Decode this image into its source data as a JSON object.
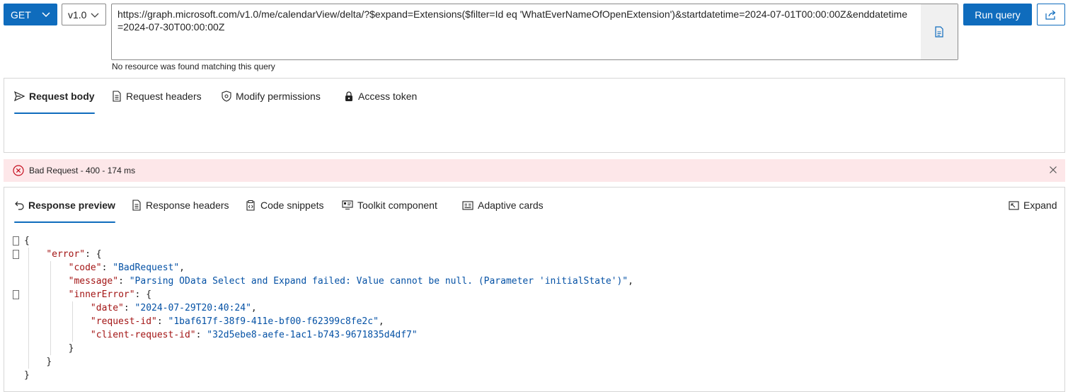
{
  "query": {
    "method": "GET",
    "version": "v1.0",
    "url": "https://graph.microsoft.com/v1.0/me/calendarView/delta/?$expand=Extensions($filter=Id eq 'WhatEverNameOfOpenExtension')&startdatetime=2024-07-01T00:00:00Z&enddatetime=2024-07-30T00:00:00Z",
    "hint": "No resource was found matching this query",
    "run_label": "Run query"
  },
  "request_tabs": [
    {
      "label": "Request body",
      "icon": "send-icon"
    },
    {
      "label": "Request headers",
      "icon": "document-icon"
    },
    {
      "label": "Modify permissions",
      "icon": "shield-icon"
    },
    {
      "label": "Access token",
      "icon": "lock-icon"
    }
  ],
  "status": {
    "text": "Bad Request - 400 - 174 ms",
    "color": "#fde7e9"
  },
  "response_tabs": [
    {
      "label": "Response preview",
      "icon": "arrow-back-icon"
    },
    {
      "label": "Response headers",
      "icon": "document-icon"
    },
    {
      "label": "Code snippets",
      "icon": "code-clipboard-icon"
    },
    {
      "label": "Toolkit component",
      "icon": "toolkit-icon"
    },
    {
      "label": "Adaptive cards",
      "icon": "card-icon"
    }
  ],
  "expand_label": "Expand",
  "response_lines": [
    {
      "indent": 0,
      "key": "",
      "value": "",
      "text": "{"
    },
    {
      "indent": 1,
      "key": "\"error\"",
      "value": "",
      "text": ": {"
    },
    {
      "indent": 2,
      "key": "\"code\"",
      "value": "\"BadRequest\"",
      "text": ","
    },
    {
      "indent": 2,
      "key": "\"message\"",
      "value": "\"Parsing OData Select and Expand failed: Value cannot be null. (Parameter 'initialState')\"",
      "text": ","
    },
    {
      "indent": 2,
      "key": "\"innerError\"",
      "value": "",
      "text": ": {"
    },
    {
      "indent": 3,
      "key": "\"date\"",
      "value": "\"2024-07-29T20:40:24\"",
      "text": ","
    },
    {
      "indent": 3,
      "key": "\"request-id\"",
      "value": "\"1baf617f-38f9-411e-bf00-f62399c8fe2c\"",
      "text": ","
    },
    {
      "indent": 3,
      "key": "\"client-request-id\"",
      "value": "\"32d5ebe8-aefe-1ac1-b743-9671835d4df7\"",
      "text": ""
    },
    {
      "indent": 2,
      "key": "",
      "value": "",
      "text": "}"
    },
    {
      "indent": 1,
      "key": "",
      "value": "",
      "text": "}"
    },
    {
      "indent": 0,
      "key": "",
      "value": "",
      "text": "}"
    }
  ]
}
